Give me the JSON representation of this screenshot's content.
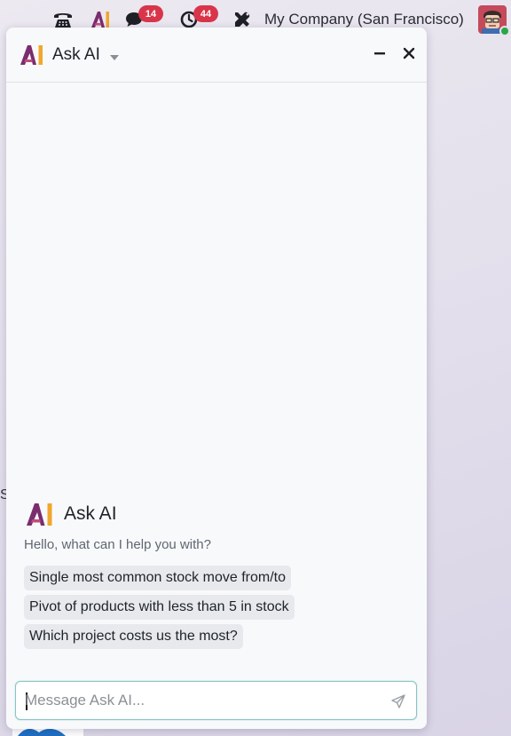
{
  "topbar": {
    "chat_count": "14",
    "activity_count": "44",
    "company": "My Company (San Francisco)",
    "icons": [
      "phone-icon",
      "ask-ai-icon",
      "chat-icon",
      "activity-clock-icon",
      "tools-icon",
      "user-avatar"
    ],
    "badge_color": "#d9354a"
  },
  "background": {
    "edge_letter": "S"
  },
  "panel": {
    "title": "Ask AI",
    "welcome_title": "Ask AI",
    "greeting": "Hello, what can I help you with?",
    "suggestions": [
      "Single most common stock move from/to",
      "Pivot of products with less than 5 in stock",
      "Which project costs us the most?"
    ],
    "input_placeholder": "Message Ask AI...",
    "accent_color": "#017e84",
    "logo_colors": [
      "#7b2d6e",
      "#f0a72b"
    ]
  }
}
